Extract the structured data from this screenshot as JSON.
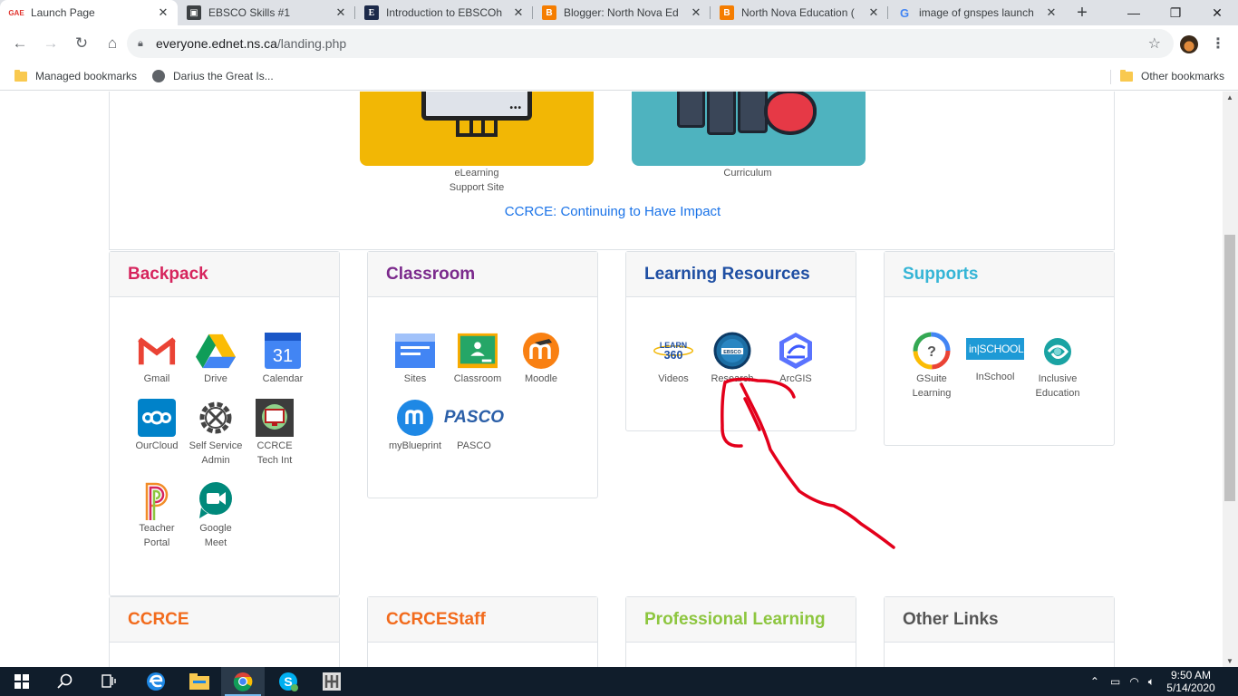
{
  "browser": {
    "tabs": [
      {
        "favicon": "gnspes-favicon",
        "title": "Launch Page",
        "active": true
      },
      {
        "favicon": "portrait-favicon",
        "title": "EBSCO Skills #1",
        "active": false
      },
      {
        "favicon": "ebsco-e-favicon",
        "title": "Introduction to EBSCOh",
        "active": false
      },
      {
        "favicon": "blogger-favicon",
        "title": "Blogger: North Nova Ed",
        "active": false
      },
      {
        "favicon": "blogger-favicon",
        "title": "North Nova Education (",
        "active": false
      },
      {
        "favicon": "google-favicon",
        "title": "image of gnspes launch",
        "active": false
      }
    ],
    "new_tab_symbol": "+",
    "url_host": "everyone.ednet.ns.ca",
    "url_path": "/landing.php",
    "bookmarks": [
      {
        "icon": "folder-icon",
        "label": "Managed bookmarks"
      },
      {
        "icon": "globe-icon",
        "label": "Darius the Great Is..."
      }
    ],
    "other_bookmarks": "Other bookmarks"
  },
  "top_section": {
    "tiles": [
      {
        "label_line1": "eLearning",
        "label_line2": "Support Site",
        "color": "#f2b705"
      },
      {
        "label_line1": "Curriculum",
        "label_line2": "",
        "color": "#4eb3bf"
      }
    ],
    "link": "CCRCE: Continuing to Have Impact"
  },
  "cards": {
    "backpack": {
      "title": "Backpack",
      "color": "#d6245d",
      "apps": [
        {
          "line1": "Gmail",
          "line2": ""
        },
        {
          "line1": "Drive",
          "line2": ""
        },
        {
          "line1": "Calendar",
          "line2": ""
        },
        {
          "line1": "OurCloud",
          "line2": ""
        },
        {
          "line1": "Self Service",
          "line2": "Admin"
        },
        {
          "line1": "CCRCE",
          "line2": "Tech Int"
        },
        {
          "line1": "Teacher",
          "line2": "Portal"
        },
        {
          "line1": "Google",
          "line2": "Meet"
        }
      ],
      "calendar_day": "31"
    },
    "classroom": {
      "title": "Classroom",
      "color": "#7b2a8c",
      "apps": [
        {
          "line1": "Sites",
          "line2": ""
        },
        {
          "line1": "Classroom",
          "line2": ""
        },
        {
          "line1": "Moodle",
          "line2": ""
        },
        {
          "line1": "myBlueprint",
          "line2": ""
        },
        {
          "line1": "PASCO",
          "line2": ""
        }
      ],
      "pasco_logo": "PASCO"
    },
    "learning": {
      "title": "Learning Resources",
      "color": "#1f4fa3",
      "apps": [
        {
          "line1": "Videos",
          "line2": ""
        },
        {
          "line1": "Research",
          "line2": ""
        },
        {
          "line1": "ArcGIS",
          "line2": ""
        }
      ],
      "learn360_logo": "LEARN 360",
      "ebsco_logo": "EBSCO"
    },
    "supports": {
      "title": "Supports",
      "color": "#35b5d6",
      "apps": [
        {
          "line1": "GSuite",
          "line2": "Learning"
        },
        {
          "line1": "InSchool",
          "line2": ""
        },
        {
          "line1": "Inclusive",
          "line2": "Education"
        }
      ],
      "inschool_logo": "in|SCHOOL"
    },
    "ccrce": {
      "title": "CCRCE",
      "color": "#f26b1d"
    },
    "ccrcestaff": {
      "title": "CCRCEStaff",
      "color": "#f26b1d"
    },
    "professional": {
      "title": "Professional Learning",
      "color": "#8dc63f"
    },
    "other": {
      "title": "Other Links",
      "color": "#555555"
    }
  },
  "taskbar": {
    "apps": [
      "windows-start-icon",
      "search-icon",
      "task-view-icon",
      "edge-icon",
      "file-explorer-icon",
      "chrome-icon",
      "skype-icon",
      "app-icon"
    ],
    "time": "9:50 AM",
    "date": "5/14/2020"
  },
  "annotation_color": "#e3001b"
}
